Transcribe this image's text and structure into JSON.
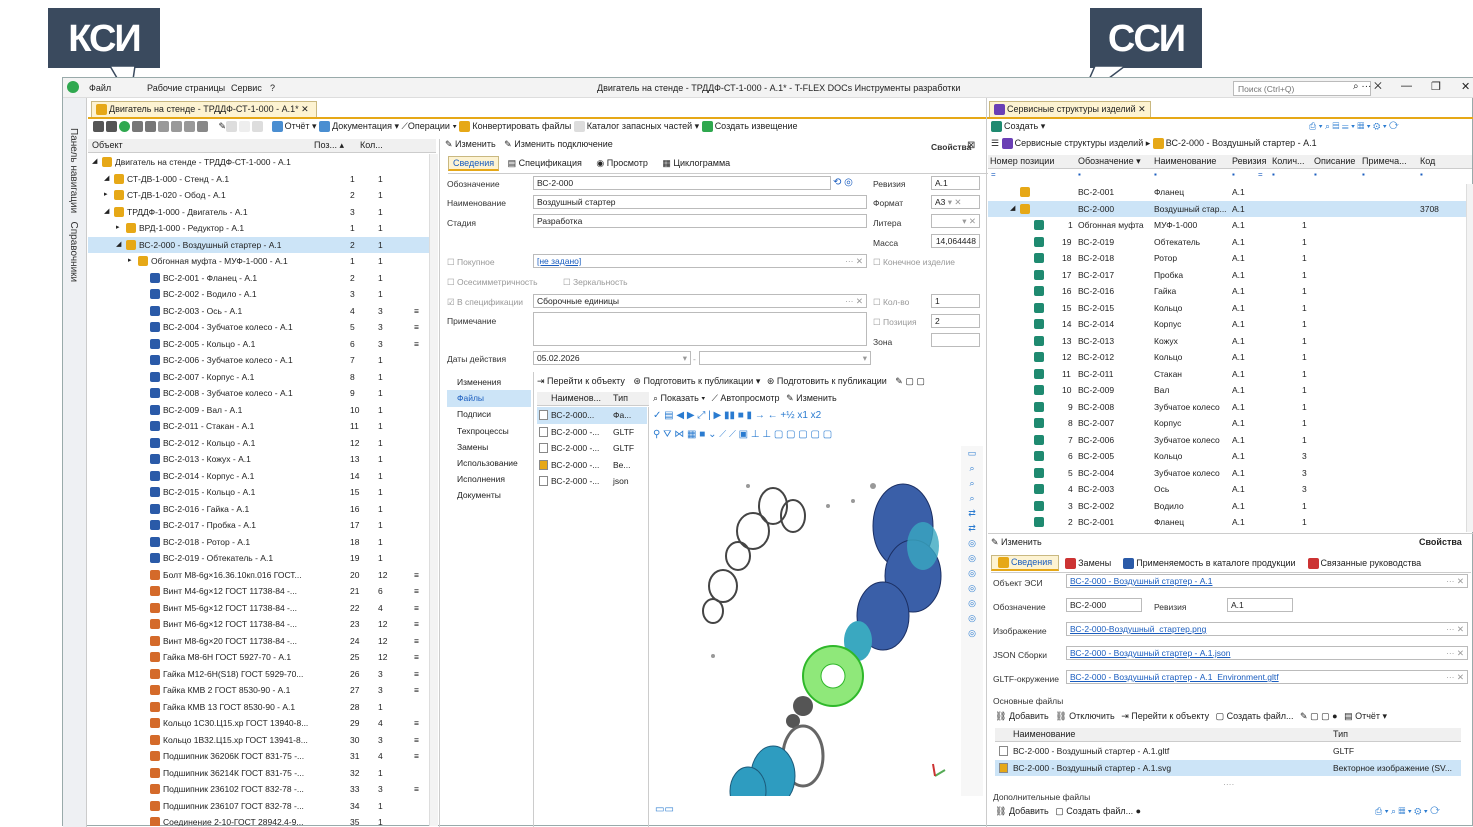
{
  "callouts": {
    "left": "КСИ",
    "right": "ССИ"
  },
  "menu": {
    "file": "Файл",
    "pages": "Рабочие страницы",
    "service": "Сервис",
    "help": "?"
  },
  "window_title": "Двигатель на стенде - ТРДДФ-СТ-1-000 - А.1* - T-FLEX DOCs Инструменты разработки",
  "search": {
    "placeholder": "Поиск (Ctrl+Q)"
  },
  "side": {
    "nav": "Панель навигации",
    "refs": "Справочники"
  },
  "left_tab": "Двигатель на стенде - ТРДДФ-СТ-1-000 - А.1*",
  "tree_head": {
    "object": "Объект",
    "pos": "Поз...",
    "qty": "Кол..."
  },
  "tree": [
    {
      "t": "Двигатель на стенде - ТРДДФ-СТ-1-000 - А.1",
      "p": "",
      "q": "",
      "i": 0,
      "k": "asm"
    },
    {
      "t": "СТ-ДВ-1-000 - Стенд - А.1",
      "p": "1",
      "q": "1",
      "i": 1,
      "k": "asm"
    },
    {
      "t": "СТ-ДВ-1-020 - Обод - А.1",
      "p": "2",
      "q": "1",
      "i": 1,
      "k": "asm"
    },
    {
      "t": "ТРДДФ-1-000 - Двигатель - А.1",
      "p": "3",
      "q": "1",
      "i": 1,
      "k": "asm"
    },
    {
      "t": "ВРД-1-000 - Редуктор - А.1",
      "p": "1",
      "q": "1",
      "i": 2,
      "k": "asm"
    },
    {
      "t": "ВС-2-000 - Воздушный стартер - А.1",
      "p": "2",
      "q": "1",
      "i": 2,
      "k": "asm",
      "sel": true
    },
    {
      "t": "Обгонная муфта - МУФ-1-000 - А.1",
      "p": "1",
      "q": "1",
      "i": 3,
      "k": "asm"
    },
    {
      "t": "ВС-2-001 - Фланец - А.1",
      "p": "2",
      "q": "1",
      "i": 4,
      "k": "part"
    },
    {
      "t": "ВС-2-002 - Водило - А.1",
      "p": "3",
      "q": "1",
      "i": 4,
      "k": "part"
    },
    {
      "t": "ВС-2-003 - Ось - А.1",
      "p": "4",
      "q": "3",
      "i": 4,
      "k": "part",
      "m": true
    },
    {
      "t": "ВС-2-004 - Зубчатое колесо - А.1",
      "p": "5",
      "q": "3",
      "i": 4,
      "k": "part",
      "m": true
    },
    {
      "t": "ВС-2-005 - Кольцо - А.1",
      "p": "6",
      "q": "3",
      "i": 4,
      "k": "part",
      "m": true
    },
    {
      "t": "ВС-2-006 - Зубчатое колесо - А.1",
      "p": "7",
      "q": "1",
      "i": 4,
      "k": "part"
    },
    {
      "t": "ВС-2-007 - Корпус - А.1",
      "p": "8",
      "q": "1",
      "i": 4,
      "k": "part"
    },
    {
      "t": "ВС-2-008 - Зубчатое колесо - А.1",
      "p": "9",
      "q": "1",
      "i": 4,
      "k": "part"
    },
    {
      "t": "ВС-2-009 - Вал - А.1",
      "p": "10",
      "q": "1",
      "i": 4,
      "k": "part"
    },
    {
      "t": "ВС-2-011 - Стакан - А.1",
      "p": "11",
      "q": "1",
      "i": 4,
      "k": "part"
    },
    {
      "t": "ВС-2-012 - Кольцо - А.1",
      "p": "12",
      "q": "1",
      "i": 4,
      "k": "part"
    },
    {
      "t": "ВС-2-013 - Кожух - А.1",
      "p": "13",
      "q": "1",
      "i": 4,
      "k": "part"
    },
    {
      "t": "ВС-2-014 - Корпус - А.1",
      "p": "14",
      "q": "1",
      "i": 4,
      "k": "part"
    },
    {
      "t": "ВС-2-015 - Кольцо - А.1",
      "p": "15",
      "q": "1",
      "i": 4,
      "k": "part"
    },
    {
      "t": "ВС-2-016 - Гайка - А.1",
      "p": "16",
      "q": "1",
      "i": 4,
      "k": "part"
    },
    {
      "t": "ВС-2-017 - Пробка - А.1",
      "p": "17",
      "q": "1",
      "i": 4,
      "k": "part"
    },
    {
      "t": "ВС-2-018 - Ротор - А.1",
      "p": "18",
      "q": "1",
      "i": 4,
      "k": "part"
    },
    {
      "t": "ВС-2-019 - Обтекатель - А.1",
      "p": "19",
      "q": "1",
      "i": 4,
      "k": "part"
    },
    {
      "t": "Болт М8-6g×16.36.10кп.016 ГОСТ...",
      "p": "20",
      "q": "12",
      "i": 4,
      "k": "std",
      "m": true
    },
    {
      "t": "Винт М4-6g×12 ГОСТ 11738-84 -...",
      "p": "21",
      "q": "6",
      "i": 4,
      "k": "std",
      "m": true
    },
    {
      "t": "Винт М5-6g×12 ГОСТ 11738-84 -...",
      "p": "22",
      "q": "4",
      "i": 4,
      "k": "std",
      "m": true
    },
    {
      "t": "Винт М6-6g×12 ГОСТ 11738-84 -...",
      "p": "23",
      "q": "12",
      "i": 4,
      "k": "std",
      "m": true
    },
    {
      "t": "Винт М8-6g×20 ГОСТ 11738-84 -...",
      "p": "24",
      "q": "12",
      "i": 4,
      "k": "std",
      "m": true
    },
    {
      "t": "Гайка М8-6Н ГОСТ 5927-70 - А.1",
      "p": "25",
      "q": "12",
      "i": 4,
      "k": "std",
      "m": true
    },
    {
      "t": "Гайка М12-6Н(S18) ГОСТ 5929-70...",
      "p": "26",
      "q": "3",
      "i": 4,
      "k": "std",
      "m": true
    },
    {
      "t": "Гайка КМВ 2 ГОСТ 8530-90 - А.1",
      "p": "27",
      "q": "3",
      "i": 4,
      "k": "std",
      "m": true
    },
    {
      "t": "Гайка КМВ 13 ГОСТ 8530-90 - А.1",
      "p": "28",
      "q": "1",
      "i": 4,
      "k": "std"
    },
    {
      "t": "Кольцо 1С30.Ц15.хр ГОСТ 13940-8...",
      "p": "29",
      "q": "4",
      "i": 4,
      "k": "std",
      "m": true
    },
    {
      "t": "Кольцо 1В32.Ц15.хр ГОСТ 13941-8...",
      "p": "30",
      "q": "3",
      "i": 4,
      "k": "std",
      "m": true
    },
    {
      "t": "Подшипник 36206К ГОСТ 831-75 -...",
      "p": "31",
      "q": "4",
      "i": 4,
      "k": "std",
      "m": true
    },
    {
      "t": "Подшипник 36214К ГОСТ 831-75 -...",
      "p": "32",
      "q": "1",
      "i": 4,
      "k": "std"
    },
    {
      "t": "Подшипник 236102 ГОСТ 832-78 -...",
      "p": "33",
      "q": "3",
      "i": 4,
      "k": "std",
      "m": true
    },
    {
      "t": "Подшипник 236107 ГОСТ 832-78 -...",
      "p": "34",
      "q": "1",
      "i": 4,
      "k": "std"
    },
    {
      "t": "Соединение 2-10-ГОСТ 28942.4-9...",
      "p": "35",
      "q": "1",
      "i": 4,
      "k": "std"
    }
  ],
  "left_toolbar": {
    "report": "Отчёт",
    "docs": "Документация",
    "ops": "Операции",
    "convert": "Конвертировать файлы",
    "catalog": "Каталог запасных частей",
    "notice": "Создать извещение"
  },
  "mid": {
    "edit": "Изменить",
    "edit_link": "Изменить подключение",
    "props": "Свойства",
    "tabs": {
      "info": "Сведения",
      "spec": "Спецификация",
      "view": "Просмотр",
      "cyclo": "Циклограмма"
    },
    "labels": {
      "designation": "Обозначение",
      "name": "Наименование",
      "stage": "Стадия",
      "revision": "Ревизия",
      "format": "Формат",
      "litera": "Литера",
      "mass": "Масса",
      "purchased": "Покупное",
      "final": "Конечное изделие",
      "axisym": "Осесимметричность",
      "mirror": "Зеркальность",
      "inspec": "В спецификации",
      "qty": "Кол-во",
      "position": "Позиция",
      "zone": "Зона",
      "note": "Примечание",
      "dates": "Даты действия"
    },
    "values": {
      "designation": "ВС-2-000",
      "name": "Воздушный стартер",
      "stage": "Разработка",
      "revision": "А.1",
      "format": "А3",
      "mass": "14,064448",
      "purchased": "[не задано]",
      "inspec": "Сборочные единицы",
      "qty": "1",
      "position": "2",
      "date": "05.02.2026"
    },
    "side_tabs": [
      "Изменения",
      "Файлы",
      "Подписи",
      "Техпроцессы",
      "Замены",
      "Использование",
      "Исполнения",
      "Документы"
    ],
    "files_toolbar": {
      "goto": "Перейти к объекту",
      "prep1": "Подготовить к публикации",
      "prep2": "Подготовить к публикации"
    },
    "files_head": {
      "name": "Наименов...",
      "type": "Тип"
    },
    "files": [
      {
        "n": "ВС-2-000...",
        "t": "Фа..."
      },
      {
        "n": "ВС-2-000 -...",
        "t": "GLTF"
      },
      {
        "n": "ВС-2-000 -...",
        "t": "GLTF"
      },
      {
        "n": "ВС-2-000 -...",
        "t": "Ве..."
      },
      {
        "n": "ВС-2-000 -...",
        "t": "json"
      }
    ],
    "viewer_toolbar": {
      "show": "Показать",
      "auto": "Автопросмотр",
      "edit": "Изменить"
    }
  },
  "right": {
    "tab": "Сервисные структуры изделий",
    "create": "Создать",
    "breadcrumb": "Сервисные структуры изделий",
    "breadcrumb2": "ВС-2-000 - Воздушный стартер - А.1",
    "head": {
      "pos": "Номер позиции",
      "des": "Обозначение",
      "name": "Наименование",
      "rev": "Ревизия",
      "qty": "Колич...",
      "desc": "Описание",
      "note": "Примеча...",
      "code": "Код"
    },
    "rows": [
      {
        "p": "",
        "d": "ВС-2-001",
        "n": "Фланец",
        "r": "А.1",
        "q": "",
        "c": "",
        "lvl": 1
      },
      {
        "p": "",
        "d": "ВС-2-000",
        "n": "Воздушный стар...",
        "r": "А.1",
        "q": "",
        "c": "3708",
        "lvl": 1,
        "sel": true
      },
      {
        "p": "1",
        "d": "Обгонная муфта",
        "n": "МУФ-1-000",
        "r": "А.1",
        "q": "1",
        "c": "",
        "lvl": 2
      },
      {
        "p": "19",
        "d": "ВС-2-019",
        "n": "Обтекатель",
        "r": "А.1",
        "q": "1",
        "c": "",
        "lvl": 2
      },
      {
        "p": "18",
        "d": "ВС-2-018",
        "n": "Ротор",
        "r": "А.1",
        "q": "1",
        "c": "",
        "lvl": 2
      },
      {
        "p": "17",
        "d": "ВС-2-017",
        "n": "Пробка",
        "r": "А.1",
        "q": "1",
        "c": "",
        "lvl": 2
      },
      {
        "p": "16",
        "d": "ВС-2-016",
        "n": "Гайка",
        "r": "А.1",
        "q": "1",
        "c": "",
        "lvl": 2
      },
      {
        "p": "15",
        "d": "ВС-2-015",
        "n": "Кольцо",
        "r": "А.1",
        "q": "1",
        "c": "",
        "lvl": 2
      },
      {
        "p": "14",
        "d": "ВС-2-014",
        "n": "Корпус",
        "r": "А.1",
        "q": "1",
        "c": "",
        "lvl": 2
      },
      {
        "p": "13",
        "d": "ВС-2-013",
        "n": "Кожух",
        "r": "А.1",
        "q": "1",
        "c": "",
        "lvl": 2
      },
      {
        "p": "12",
        "d": "ВС-2-012",
        "n": "Кольцо",
        "r": "А.1",
        "q": "1",
        "c": "",
        "lvl": 2
      },
      {
        "p": "11",
        "d": "ВС-2-011",
        "n": "Стакан",
        "r": "А.1",
        "q": "1",
        "c": "",
        "lvl": 2
      },
      {
        "p": "10",
        "d": "ВС-2-009",
        "n": "Вал",
        "r": "А.1",
        "q": "1",
        "c": "",
        "lvl": 2
      },
      {
        "p": "9",
        "d": "ВС-2-008",
        "n": "Зубчатое колесо",
        "r": "А.1",
        "q": "1",
        "c": "",
        "lvl": 2
      },
      {
        "p": "8",
        "d": "ВС-2-007",
        "n": "Корпус",
        "r": "А.1",
        "q": "1",
        "c": "",
        "lvl": 2
      },
      {
        "p": "7",
        "d": "ВС-2-006",
        "n": "Зубчатое колесо",
        "r": "А.1",
        "q": "1",
        "c": "",
        "lvl": 2
      },
      {
        "p": "6",
        "d": "ВС-2-005",
        "n": "Кольцо",
        "r": "А.1",
        "q": "3",
        "c": "",
        "lvl": 2
      },
      {
        "p": "5",
        "d": "ВС-2-004",
        "n": "Зубчатое колесо",
        "r": "А.1",
        "q": "3",
        "c": "",
        "lvl": 2
      },
      {
        "p": "4",
        "d": "ВС-2-003",
        "n": "Ось",
        "r": "А.1",
        "q": "3",
        "c": "",
        "lvl": 2
      },
      {
        "p": "3",
        "d": "ВС-2-002",
        "n": "Водило",
        "r": "А.1",
        "q": "1",
        "c": "",
        "lvl": 2
      },
      {
        "p": "2",
        "d": "ВС-2-001",
        "n": "Фланец",
        "r": "А.1",
        "q": "1",
        "c": "",
        "lvl": 2
      }
    ],
    "props": {
      "edit": "Изменить",
      "title": "Свойства",
      "tabs": [
        "Сведения",
        "Замены",
        "Применяемость в каталоге продукции",
        "Связанные руководства"
      ],
      "labels": {
        "esi": "Объект ЭСИ",
        "des": "Обозначение",
        "rev": "Ревизия",
        "img": "Изображение",
        "json": "JSON Сборки",
        "gltf": "GLTF-окружение",
        "main": "Основные файлы",
        "extra": "Дополнительные файлы"
      },
      "values": {
        "esi": "ВС-2-000 - Воздушный стартер - А.1",
        "des": "ВС-2-000",
        "rev": "А.1",
        "img": "ВС-2-000-Воздушный_стартер.png",
        "json": "ВС-2-000 - Воздушный стартер - А.1.json",
        "gltf": "ВС-2-000 - Воздушный стартер - А.1_Environment.gltf"
      },
      "toolbar": {
        "add": "Добавить",
        "detach": "Отключить",
        "goto": "Перейти к объекту",
        "create": "Создать файл...",
        "report": "Отчёт"
      },
      "files_head": {
        "name": "Наименование",
        "type": "Тип"
      },
      "files": [
        {
          "n": "ВС-2-000 - Воздушный стартер - А.1.gltf",
          "t": "GLTF"
        },
        {
          "n": "ВС-2-000 - Воздушный стартер - А.1.svg",
          "t": "Векторное изображение (SV..."
        }
      ],
      "bottom": {
        "add": "Добавить",
        "create": "Создать файл..."
      }
    }
  },
  "colors": {
    "accent": "#cce4f7",
    "callout": "#3a4a5e",
    "gold": "#e6a817",
    "teal": "#1f8a70"
  }
}
